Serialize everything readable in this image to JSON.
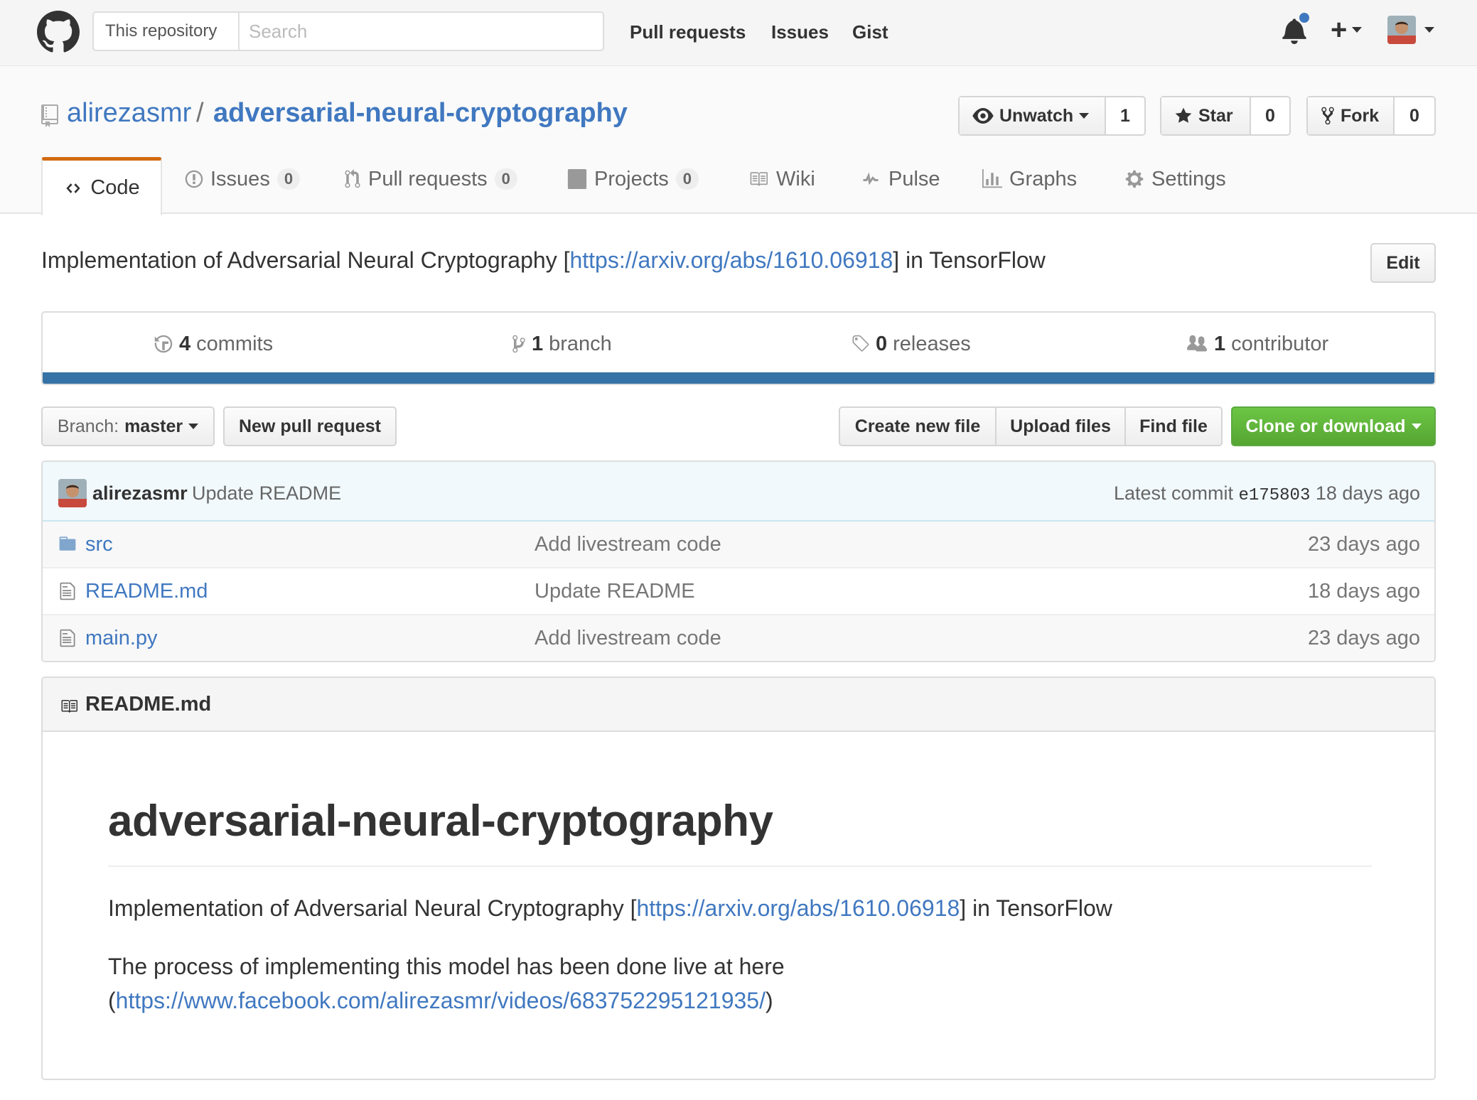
{
  "header": {
    "search_scope": "This repository",
    "search_placeholder": "Search",
    "nav": [
      "Pull requests",
      "Issues",
      "Gist"
    ]
  },
  "repo": {
    "owner": "alirezasmr",
    "separator": "/",
    "name": "adversarial-neural-cryptography",
    "watch_label": "Unwatch",
    "watch_count": "1",
    "star_label": "Star",
    "star_count": "0",
    "fork_label": "Fork",
    "fork_count": "0"
  },
  "tabs": {
    "code": "Code",
    "issues": "Issues",
    "issues_count": "0",
    "pulls": "Pull requests",
    "pulls_count": "0",
    "projects": "Projects",
    "projects_count": "0",
    "wiki": "Wiki",
    "pulse": "Pulse",
    "graphs": "Graphs",
    "settings": "Settings"
  },
  "description": {
    "prefix": "Implementation of Adversarial Neural Cryptography [",
    "link": "https://arxiv.org/abs/1610.06918",
    "suffix": "] in TensorFlow",
    "edit_label": "Edit"
  },
  "summary": {
    "commits_num": "4",
    "commits_label": "commits",
    "branch_num": "1",
    "branch_label": "branch",
    "releases_num": "0",
    "releases_label": "releases",
    "contributors_num": "1",
    "contributors_label": "contributor",
    "language_color": "#3572a5"
  },
  "toolbar": {
    "branch_prefix": "Branch:",
    "branch_name": "master",
    "new_pr": "New pull request",
    "create_file": "Create new file",
    "upload_files": "Upload files",
    "find_file": "Find file",
    "clone": "Clone or download"
  },
  "latest_commit": {
    "author": "alirezasmr",
    "message": "Update README",
    "prefix": "Latest commit",
    "sha": "e175803",
    "age": "18 days ago"
  },
  "files": [
    {
      "icon": "folder-icon",
      "name": "src",
      "message": "Add livestream code",
      "age": "23 days ago"
    },
    {
      "icon": "file-icon",
      "name": "README.md",
      "message": "Update README",
      "age": "18 days ago"
    },
    {
      "icon": "file-icon",
      "name": "main.py",
      "message": "Add livestream code",
      "age": "23 days ago"
    }
  ],
  "readme": {
    "title": "README.md",
    "h1": "adversarial-neural-cryptography",
    "p1_prefix": "Implementation of Adversarial Neural Cryptography [",
    "p1_link": "https://arxiv.org/abs/1610.06918",
    "p1_suffix": "] in TensorFlow",
    "p2_text": "The process of implementing this model has been done live at here (",
    "p2_link": "https://www.facebook.com/alirezasmr/videos/683752295121935/",
    "p2_suffix": ")"
  }
}
